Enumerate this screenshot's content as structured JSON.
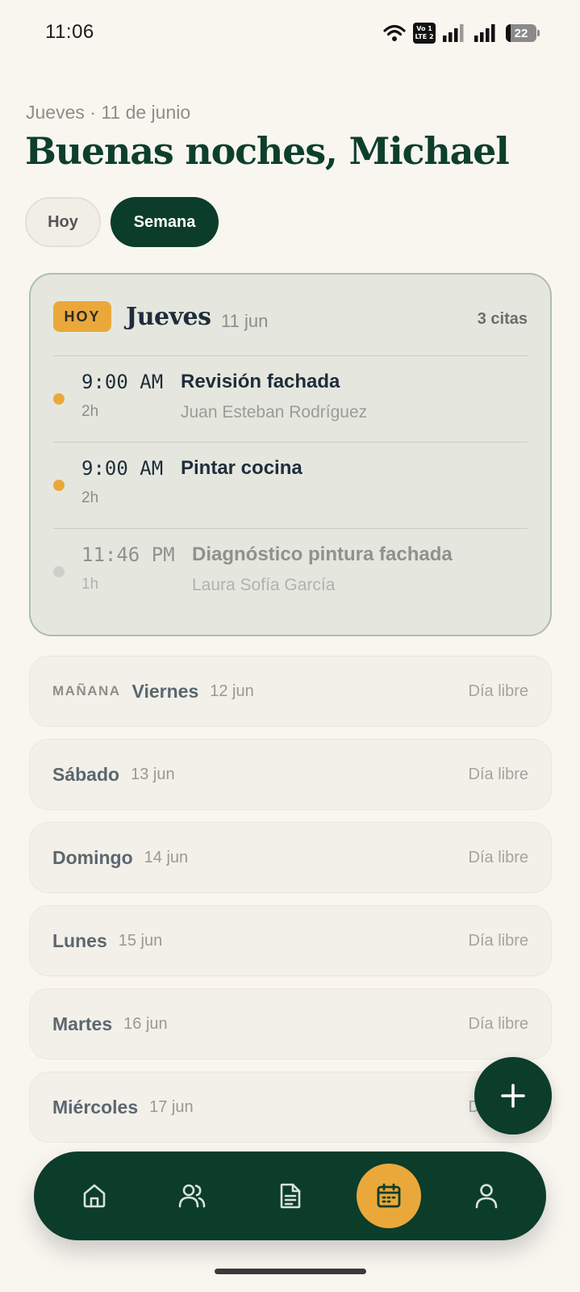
{
  "status_bar": {
    "time": "11:06",
    "volte_top": "Vo 1",
    "volte_bottom": "LTE 2",
    "battery": "22"
  },
  "header": {
    "date": "Jueves · 11 de junio",
    "greeting": "Buenas noches, Michael"
  },
  "view_toggle": {
    "options": [
      {
        "label": "Hoy",
        "selected": false
      },
      {
        "label": "Semana",
        "selected": true
      }
    ]
  },
  "today": {
    "badge": "HOY",
    "day": "Jueves",
    "date": "11 jun",
    "count": "3 citas",
    "appointments": [
      {
        "time": "9:00 AM",
        "duration": "2h",
        "title": "Revisión fachada",
        "client": "Juan Esteban Rodríguez",
        "status": "upcoming"
      },
      {
        "time": "9:00 AM",
        "duration": "2h",
        "title": "Pintar cocina",
        "client": "",
        "status": "upcoming"
      },
      {
        "time": "11:46 PM",
        "duration": "1h",
        "title": "Diagnóstico pintura fachada",
        "client": "Laura Sofía García",
        "status": "past"
      }
    ]
  },
  "week": [
    {
      "tag": "MAÑANA",
      "day": "Viernes",
      "date": "12 jun",
      "status": "Día libre"
    },
    {
      "tag": "",
      "day": "Sábado",
      "date": "13 jun",
      "status": "Día libre"
    },
    {
      "tag": "",
      "day": "Domingo",
      "date": "14 jun",
      "status": "Día libre"
    },
    {
      "tag": "",
      "day": "Lunes",
      "date": "15 jun",
      "status": "Día libre"
    },
    {
      "tag": "",
      "day": "Martes",
      "date": "16 jun",
      "status": "Día libre"
    },
    {
      "tag": "",
      "day": "Miércoles",
      "date": "17 jun",
      "status": "Día libre"
    }
  ],
  "fab": {
    "icon": "plus-icon"
  },
  "bottom_nav": {
    "items": [
      {
        "icon": "home-icon",
        "active": false
      },
      {
        "icon": "users-icon",
        "active": false
      },
      {
        "icon": "document-icon",
        "active": false
      },
      {
        "icon": "calendar-icon",
        "active": true
      },
      {
        "icon": "user-icon",
        "active": false
      }
    ]
  },
  "colors": {
    "background": "#f9f6f0",
    "primary": "#0b3d2a",
    "accent": "#eba83a",
    "today_card": "#e5e7df",
    "upcoming_dot": "#eba83a",
    "past_dot": "#cfcfca"
  }
}
